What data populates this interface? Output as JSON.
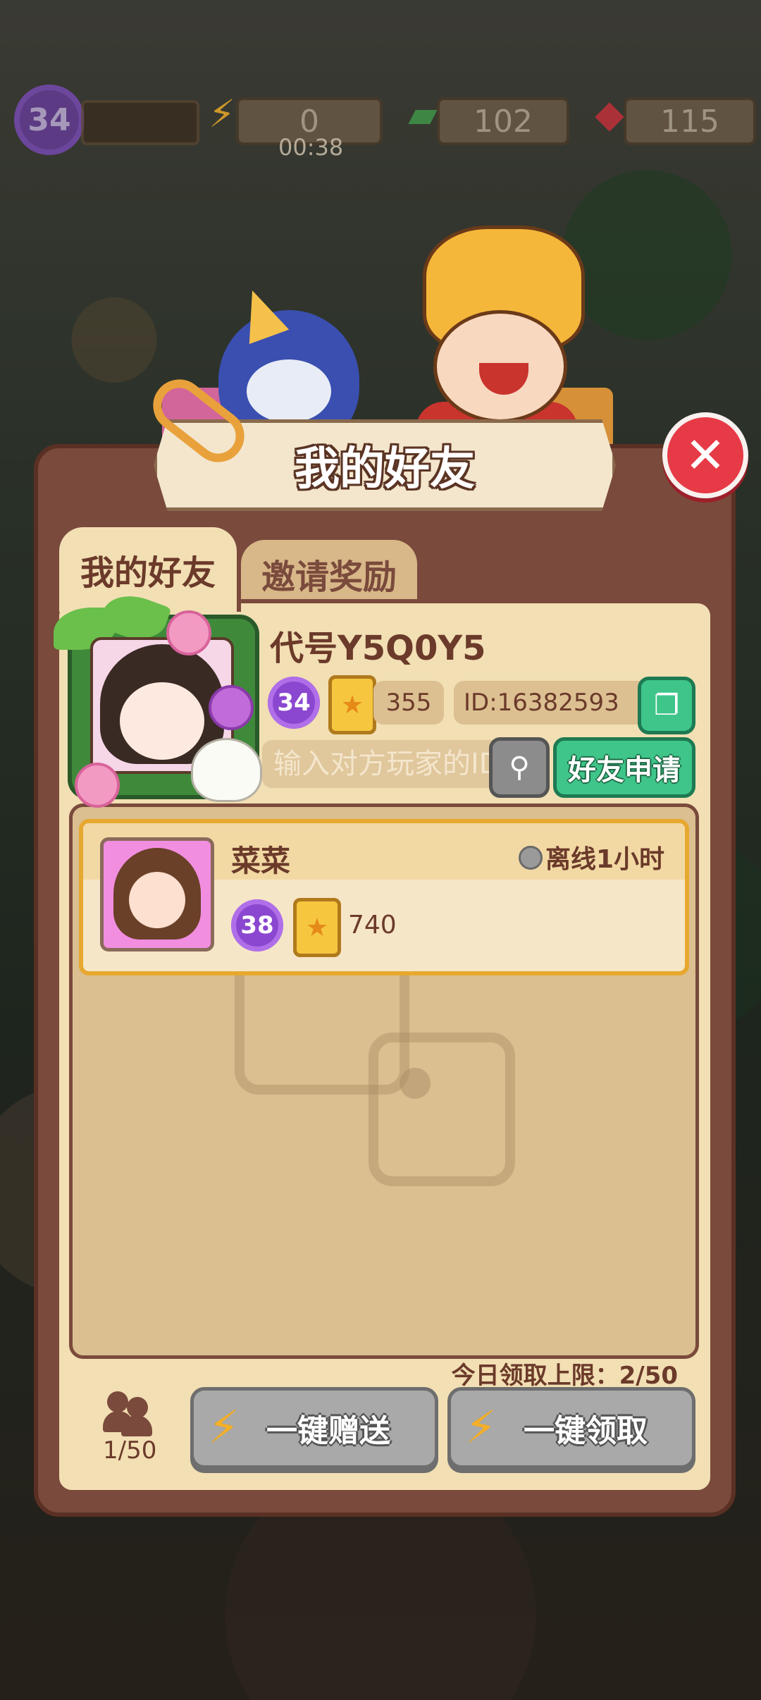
{
  "colors": {
    "panel_brown": "#7a4a3c",
    "cream": "#f2dfb4",
    "green_button": "#3fc58a",
    "close_red": "#e63a46",
    "gray_button": "#a9a9a9",
    "level_purple": "#8b47d0"
  },
  "topbar": {
    "level": "34",
    "energy": "0",
    "energy_timer": "00:38",
    "cash": "102",
    "gems": "115"
  },
  "panel": {
    "title": "我的好友",
    "close_icon": "close-icon"
  },
  "tabs": [
    {
      "label": "我的好友",
      "active": true
    },
    {
      "label": "邀请奖励",
      "active": false
    }
  ],
  "profile": {
    "codename": "代号Y5Q0Y5",
    "level": "34",
    "stars": "355",
    "id_text": "ID:16382593"
  },
  "search": {
    "placeholder": "输入对方玩家的ID",
    "apply_label": "好友申请"
  },
  "friends": [
    {
      "name": "菜菜",
      "status": "离线1小时",
      "level": "38",
      "stars": "740"
    }
  ],
  "footer": {
    "limit_text": "今日领取上限：2/50",
    "friend_count": "1/50",
    "send_all_label": "一键赠送",
    "claim_all_label": "一键领取"
  }
}
